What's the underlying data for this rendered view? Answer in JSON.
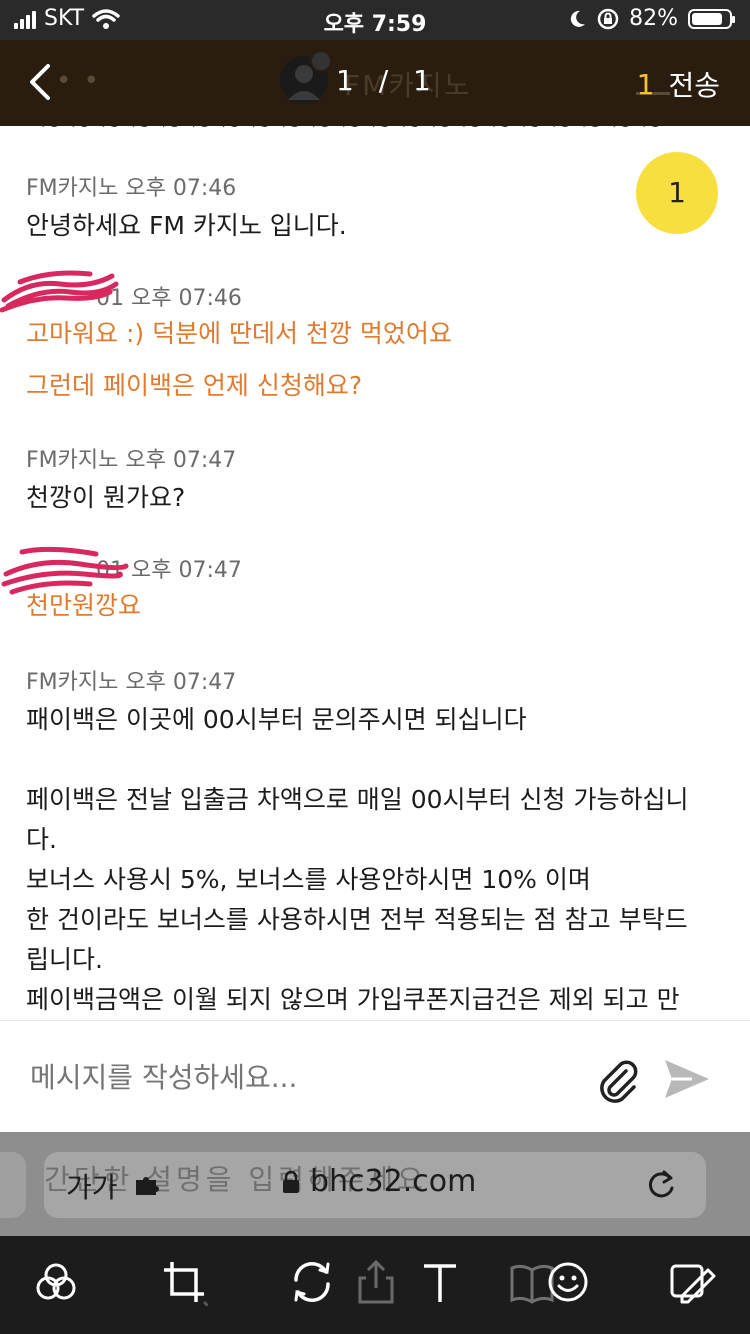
{
  "status_bar": {
    "carrier": "SKT",
    "time": "오후 7:59",
    "battery": "82%",
    "battery_level": 0.82
  },
  "header": {
    "pager": "1 / 1",
    "ghost_title": "FM카지노",
    "send_count": "1",
    "send_label": "전송"
  },
  "badge": "1",
  "messages": [
    {
      "sender": "FM카지노",
      "time": "오후 07:46",
      "lines": [
        "안녕하세요 FM 카지노 입니다."
      ]
    },
    {
      "sender": "01",
      "time": "오후 07:46",
      "lines": [
        "고마워요 :) 덕분에 딴데서 천깡 먹었어요",
        "그런데 페이백은 언제 신청해요?"
      ]
    },
    {
      "sender": "FM카지노",
      "time": "오후 07:47",
      "lines": [
        "천깡이 뭔가요?"
      ]
    },
    {
      "sender": "01",
      "time": "오후 07:47",
      "lines": [
        "천만원깡요"
      ]
    },
    {
      "sender": "FM카지노",
      "time": "오후 07:47",
      "lines": [
        "패이백은 이곳에 00시부터 문의주시면 되십니다",
        "",
        "페이백은 전날 입출금 차액으로 매일 00시부터 신청 가능하십니",
        "다.",
        "보너스 사용시 5%, 보너스를 사용안하시면 10% 이며",
        "한 건이라도 보너스를 사용하시면 전부 적용되는 점 참고 부탁드",
        "립니다.",
        "페이백금액은 이월 되지 않으며 가입쿠폰지급건은 제외 되고 만"
      ]
    }
  ],
  "composer": {
    "placeholder": "메시지를 작성하세요..."
  },
  "browser": {
    "aa": "가가",
    "url": "bhc32.com",
    "ghost_hint": "간단한 설명을 입력해주세요"
  },
  "icons": [
    "back-chevron-icon",
    "avatar-icon",
    "paperclip-icon",
    "send-arrow-icon",
    "puzzle-icon",
    "lock-icon",
    "reload-icon",
    "circles-filter-icon",
    "crop-icon",
    "rotate-icon",
    "share-icon",
    "text-icon",
    "book-icon",
    "emoji-icon",
    "edit-copy-icon"
  ]
}
